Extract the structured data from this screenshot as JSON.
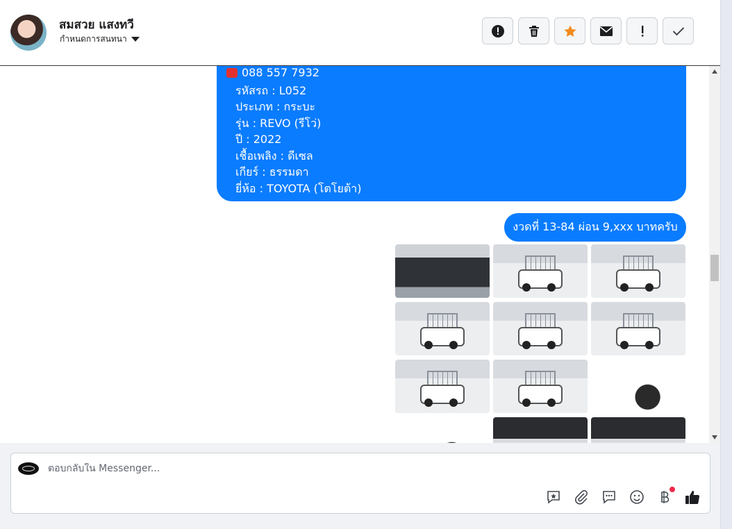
{
  "header": {
    "contact_name": "สมสวย แสงทวี",
    "conversation_settings_label": "กำหนดการสนทนา",
    "actions": [
      {
        "name": "spam",
        "icon": "alert-circle-icon"
      },
      {
        "name": "delete",
        "icon": "trash-icon"
      },
      {
        "name": "star",
        "icon": "star-icon",
        "color": "#f28b1f"
      },
      {
        "name": "mark-unread",
        "icon": "envelope-icon"
      },
      {
        "name": "follow-up",
        "icon": "exclamation-icon"
      },
      {
        "name": "done",
        "icon": "check-icon"
      }
    ]
  },
  "messages": {
    "details_phone": "088 557 7932",
    "details_lines": [
      "รหัสรถ : L052",
      "ประเภท : กระบะ",
      "รุ่น : REVO (รีโว่)",
      "ปี : 2022",
      "เชื้อเพลิง : ดีเซล",
      "เกียร์ : ธรรมดา",
      "ยี่ห้อ : TOYOTA (โตโยต้า)"
    ],
    "installment_text": "งวดที่ 13-84 ผ่อน 9,xxx บาทครับ"
  },
  "photos": [
    {
      "kind": "engine"
    },
    {
      "kind": "rack"
    },
    {
      "kind": "rack"
    },
    {
      "kind": "rack"
    },
    {
      "kind": "rack"
    },
    {
      "kind": "rack"
    },
    {
      "kind": "rack"
    },
    {
      "kind": "rack"
    },
    {
      "kind": "closeup"
    },
    {
      "kind": "closeup"
    },
    {
      "kind": "interior"
    },
    {
      "kind": "interior"
    }
  ],
  "composer": {
    "placeholder": "ตอบกลับใน Messenger...",
    "tools": [
      "saved-reply-icon",
      "attachment-icon",
      "chat-bubble-icon",
      "emoji-icon",
      "baht-icon",
      "like-icon"
    ]
  },
  "colors": {
    "bubble": "#0a7cff",
    "star": "#f28b1f",
    "notification_dot": "#f02849"
  }
}
